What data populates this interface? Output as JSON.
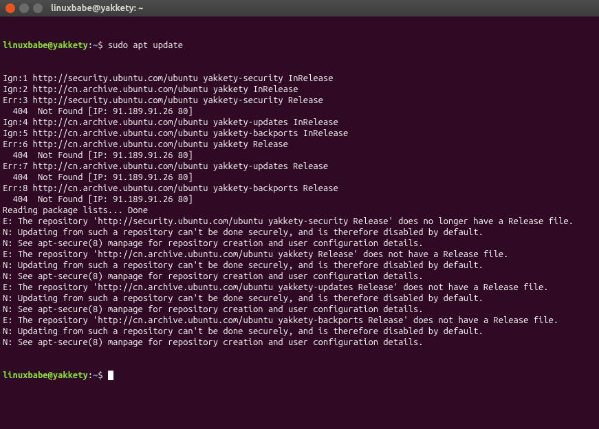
{
  "window": {
    "title": "linuxbabe@yakkety: ~"
  },
  "prompt": {
    "user_host": "linuxbabe@yakkety",
    "separator": ":",
    "path": "~",
    "symbol": "$"
  },
  "command": "sudo apt update",
  "output_lines": [
    "Ign:1 http://security.ubuntu.com/ubuntu yakkety-security InRelease",
    "Ign:2 http://cn.archive.ubuntu.com/ubuntu yakkety InRelease",
    "Err:3 http://security.ubuntu.com/ubuntu yakkety-security Release",
    "  404  Not Found [IP: 91.189.91.26 80]",
    "Ign:4 http://cn.archive.ubuntu.com/ubuntu yakkety-updates InRelease",
    "Ign:5 http://cn.archive.ubuntu.com/ubuntu yakkety-backports InRelease",
    "Err:6 http://cn.archive.ubuntu.com/ubuntu yakkety Release",
    "  404  Not Found [IP: 91.189.91.26 80]",
    "Err:7 http://cn.archive.ubuntu.com/ubuntu yakkety-updates Release",
    "  404  Not Found [IP: 91.189.91.26 80]",
    "Err:8 http://cn.archive.ubuntu.com/ubuntu yakkety-backports Release",
    "  404  Not Found [IP: 91.189.91.26 80]",
    "Reading package lists... Done",
    "E: The repository 'http://security.ubuntu.com/ubuntu yakkety-security Release' does no longer have a Release file.",
    "N: Updating from such a repository can't be done securely, and is therefore disabled by default.",
    "N: See apt-secure(8) manpage for repository creation and user configuration details.",
    "E: The repository 'http://cn.archive.ubuntu.com/ubuntu yakkety Release' does not have a Release file.",
    "N: Updating from such a repository can't be done securely, and is therefore disabled by default.",
    "N: See apt-secure(8) manpage for repository creation and user configuration details.",
    "E: The repository 'http://cn.archive.ubuntu.com/ubuntu yakkety-updates Release' does not have a Release file.",
    "N: Updating from such a repository can't be done securely, and is therefore disabled by default.",
    "N: See apt-secure(8) manpage for repository creation and user configuration details.",
    "E: The repository 'http://cn.archive.ubuntu.com/ubuntu yakkety-backports Release' does not have a Release file.",
    "N: Updating from such a repository can't be done securely, and is therefore disabled by default.",
    "N: See apt-secure(8) manpage for repository creation and user configuration details."
  ]
}
